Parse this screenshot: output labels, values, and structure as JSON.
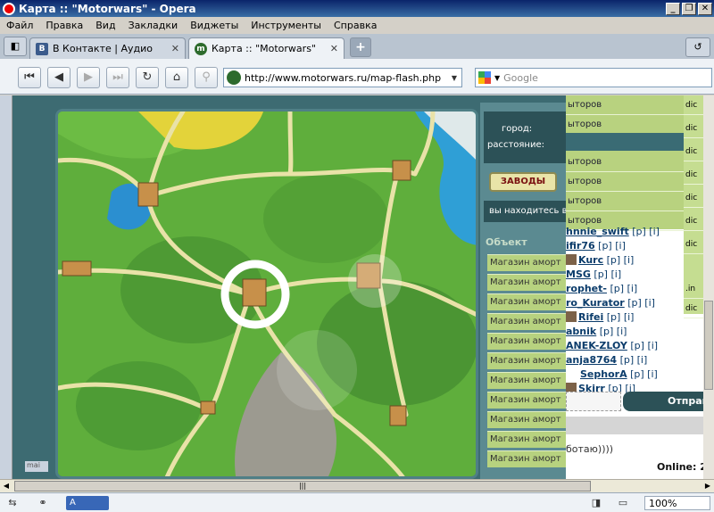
{
  "window": {
    "title": "Карта :: \"Motorwars\" - Opera",
    "minimize_glyph": "_",
    "restore_glyph": "❐",
    "close_glyph": "✕"
  },
  "menu": [
    "Файл",
    "Правка",
    "Вид",
    "Закладки",
    "Виджеты",
    "Инструменты",
    "Справка"
  ],
  "tabs": [
    {
      "favicon_glyph": "B",
      "label": "В Контакте | Аудио",
      "close_glyph": "✕",
      "active": false
    },
    {
      "favicon_glyph": "m",
      "label": "Карта :: \"Motorwars\"",
      "close_glyph": "✕",
      "active": true
    }
  ],
  "tabbar": {
    "new_tab_glyph": "+",
    "trash_glyph": "↺",
    "panel_glyph": "◧"
  },
  "nav": {
    "buttons": [
      {
        "name": "rewind-icon",
        "glyph": "⏮"
      },
      {
        "name": "back-icon",
        "glyph": "◀"
      },
      {
        "name": "forward-icon",
        "glyph": "▶"
      },
      {
        "name": "fast-forward-icon",
        "glyph": "⏭"
      },
      {
        "name": "reload-icon",
        "glyph": "↻"
      },
      {
        "name": "home-icon",
        "glyph": "⌂"
      },
      {
        "name": "wand-icon",
        "glyph": "⚲"
      }
    ],
    "address": "http://www.motorwars.ru/map-flash.php",
    "search_placeholder": "Google"
  },
  "map_panel": {
    "city_label": "город:",
    "distance_label": "расстояние:",
    "zavody_button": "ЗАВОДЫ",
    "location_text": "вы находитесь в",
    "object_header": "Объект",
    "objects": [
      "Магазин аморт",
      "Магазин аморт",
      "Магазин аморт",
      "Магазин аморт",
      "Магазин аморт",
      "Магазин аморт",
      "Магазин аморт",
      "Магазин аморт",
      "Магазин аморт",
      "Магазин аморт",
      "Магазин аморт"
    ],
    "corner_tag": "mai"
  },
  "chat": {
    "top_rows": [
      "ыторов",
      "ыторов",
      "ыторов",
      "ыторов",
      "ыторов",
      "ыторов"
    ],
    "right_cells": [
      "dic",
      "dic",
      "dic",
      "dic",
      "dic",
      "dic",
      "dic",
      ".in",
      "dic"
    ],
    "users": [
      {
        "name": "hnnie_swift",
        "avatar": false
      },
      {
        "name": "ifir76",
        "avatar": false
      },
      {
        "name": "Kurc",
        "avatar": true
      },
      {
        "name": "MSG",
        "avatar": false
      },
      {
        "name": "rophet-",
        "avatar": false
      },
      {
        "name": "ro_Kurator",
        "avatar": false
      },
      {
        "name": "Rifei",
        "avatar": true
      },
      {
        "name": "abnik",
        "avatar": false
      },
      {
        "name": "ANEK-ZLOY",
        "avatar": false
      },
      {
        "name": "anja8764",
        "avatar": false
      },
      {
        "name": "SephorA",
        "avatar": false
      },
      {
        "name": "Skirr",
        "avatar": true
      }
    ],
    "user_suffix": "[p] [i]",
    "send_label": "Отправ",
    "message": "ботаю))))",
    "online": "Online: 2"
  },
  "statusbar": {
    "lang": "A",
    "zoom": "100%"
  }
}
